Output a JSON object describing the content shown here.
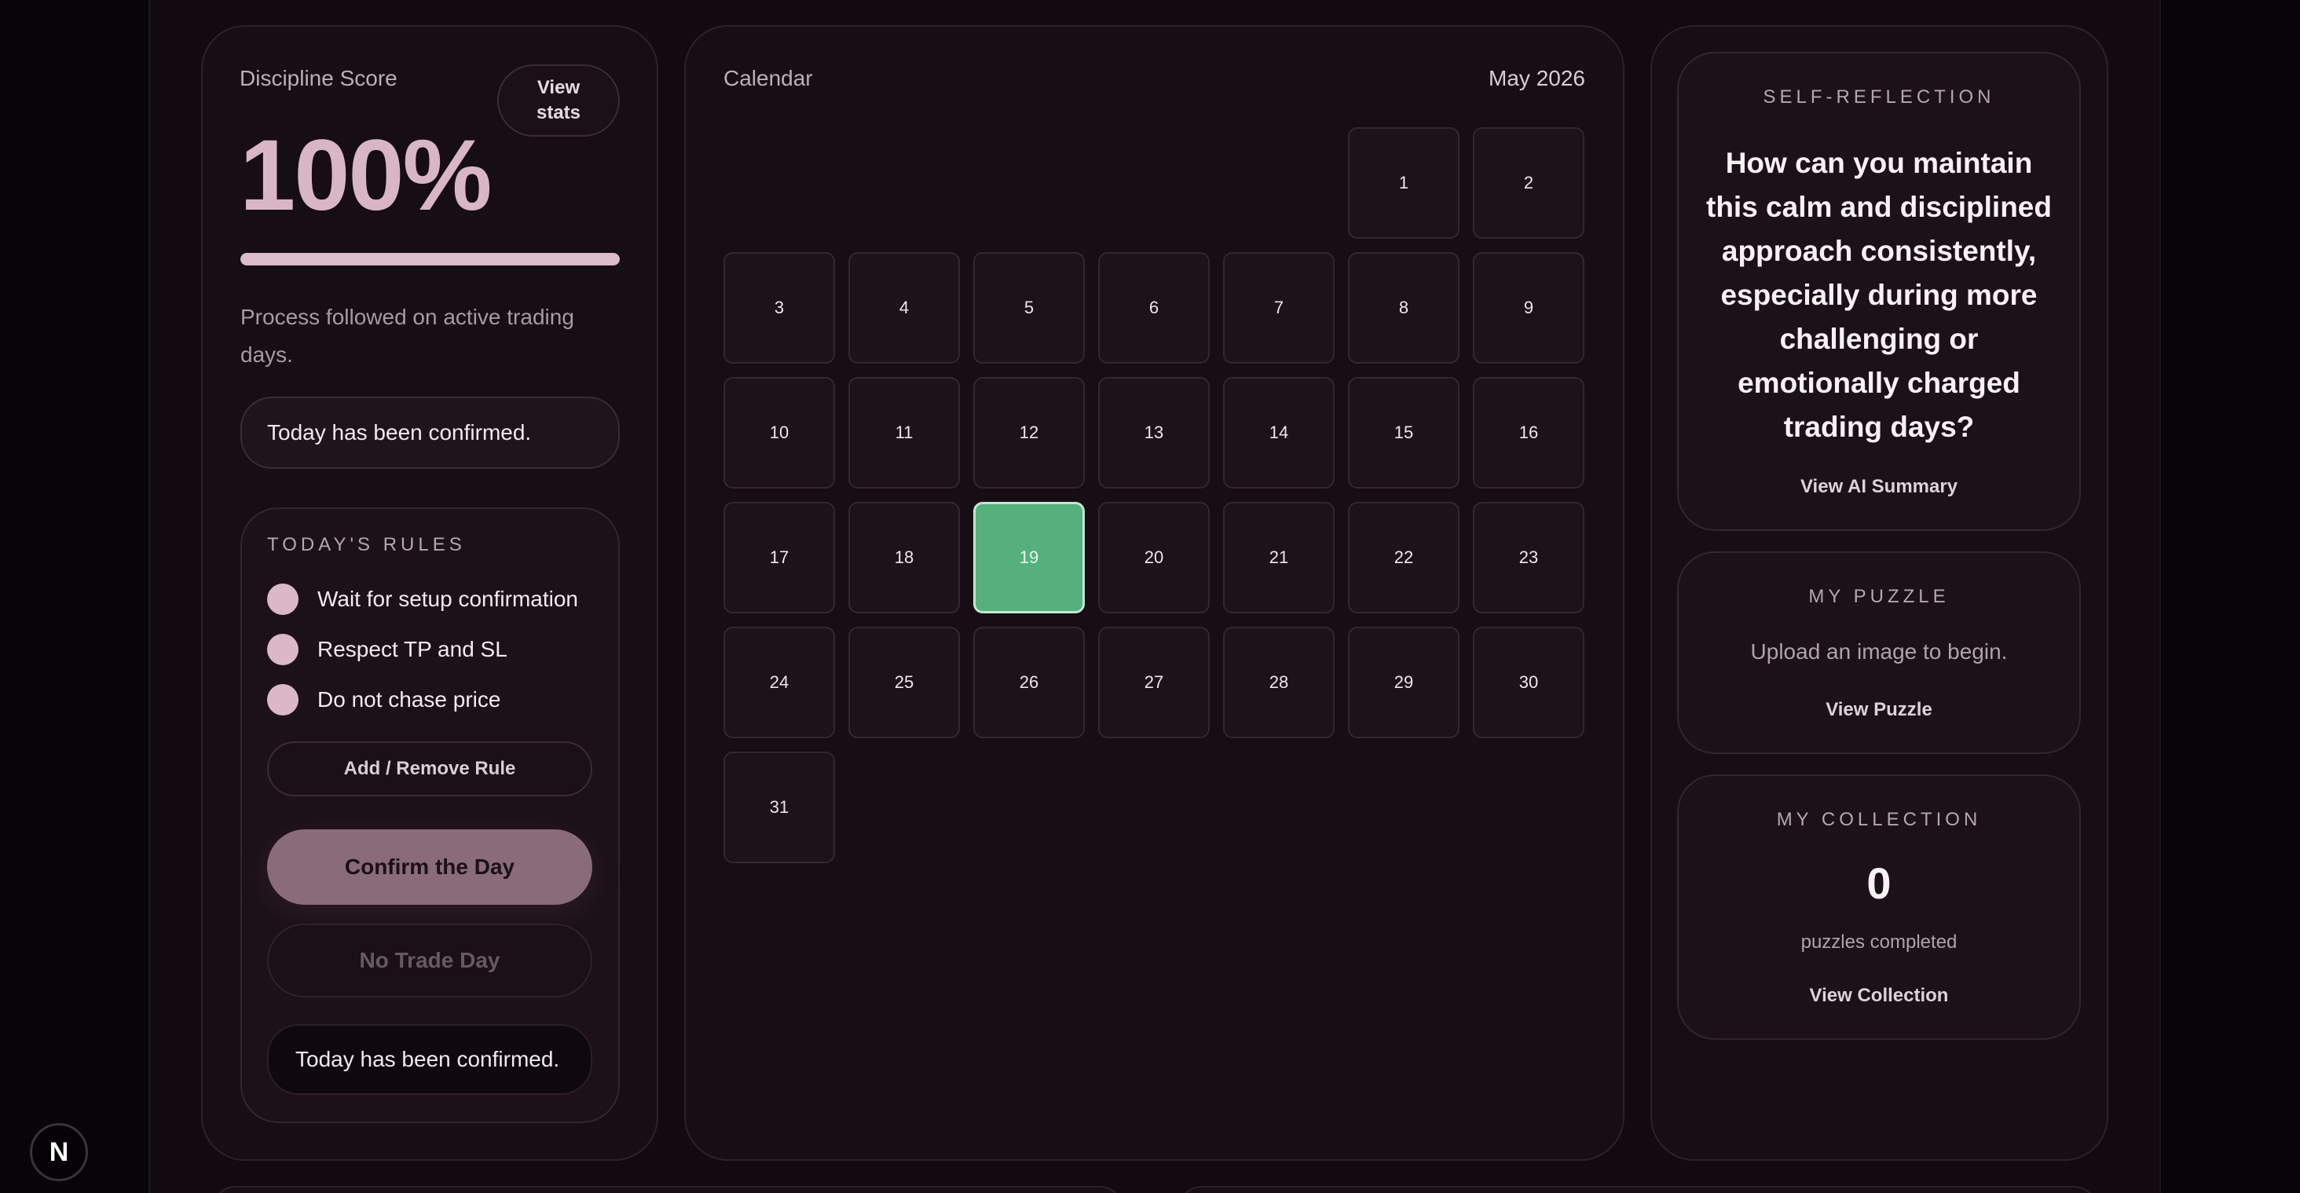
{
  "discipline": {
    "title": "Discipline Score",
    "view_stats_label": "View stats",
    "score_text": "100%",
    "score_fraction": 1.0,
    "process_text": "Process followed on active trading days.",
    "confirmed_message": "Today has been confirmed."
  },
  "rules": {
    "title": "TODAY'S RULES",
    "items": [
      "Wait for setup confirmation",
      "Respect TP and SL",
      "Do not chase price"
    ],
    "add_remove_label": "Add / Remove Rule",
    "confirm_label": "Confirm the Day",
    "no_trade_label": "No Trade Day",
    "status_message": "Today has been confirmed."
  },
  "calendar": {
    "title": "Calendar",
    "month": "May 2026",
    "first_weekday_index": 5,
    "days_in_month": 31,
    "today": 19,
    "today_color": "#55b07c"
  },
  "reflection": {
    "title": "SELF-REFLECTION",
    "question": "How can you maintain this calm and disciplined approach consistently, especially during more challenging or emotionally charged trading days?",
    "link_label": "View AI Summary"
  },
  "puzzle": {
    "title": "MY PUZZLE",
    "message": "Upload an image to begin.",
    "link_label": "View Puzzle"
  },
  "collection": {
    "title": "MY COLLECTION",
    "count": "0",
    "count_label": "puzzles completed",
    "link_label": "View Collection"
  },
  "logo": {
    "letter": "N",
    "icon": "nextjs-logo-icon"
  },
  "colors": {
    "accent_pink": "#dbb8c8",
    "background": "#130a11"
  }
}
